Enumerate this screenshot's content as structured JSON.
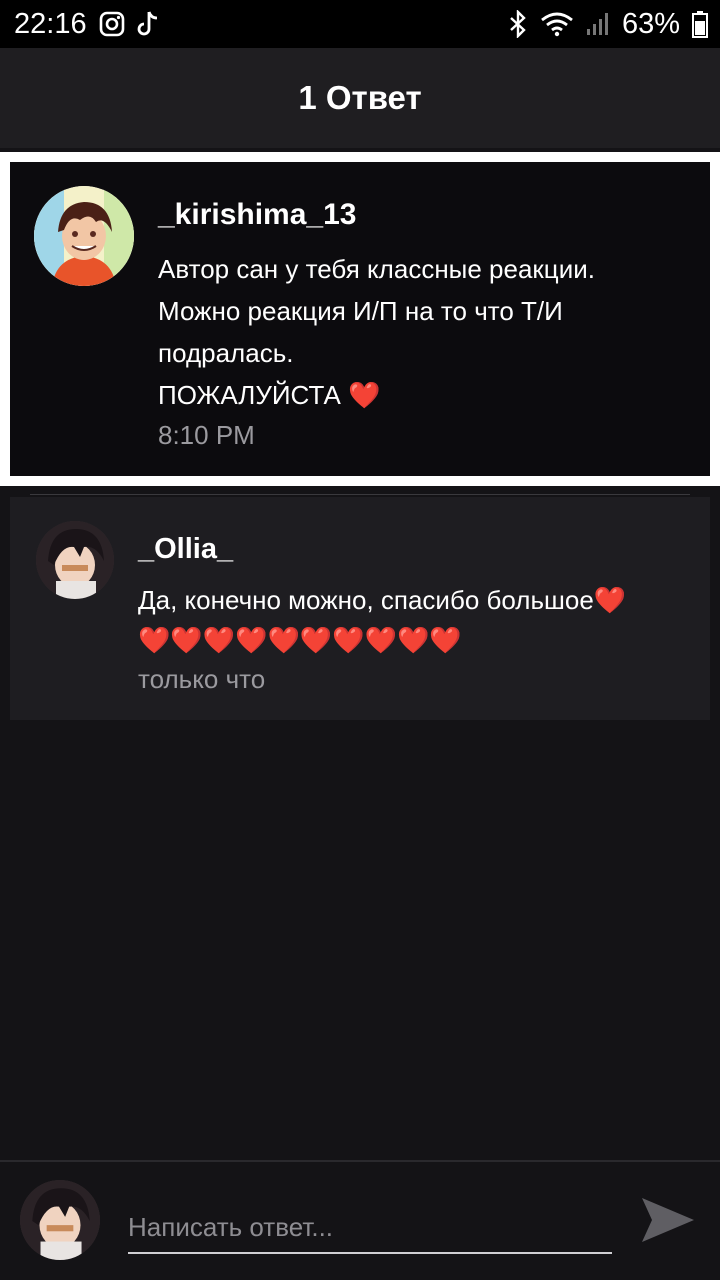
{
  "status_bar": {
    "time": "22:16",
    "battery_percent": "63%",
    "icons": [
      "instagram-icon",
      "tiktok-icon",
      "bluetooth-icon",
      "wifi-icon",
      "signal-icon",
      "battery-icon"
    ]
  },
  "header": {
    "title": "1 Ответ"
  },
  "original_comment": {
    "username": "_kirishima_13",
    "lines": [
      "Автор сан у тебя классные реакции.",
      "Можно реакция И/П на то что Т/И",
      "подралась.",
      "ПОЖАЛУЙСТА ❤️"
    ],
    "time": "8:10 PM"
  },
  "reply": {
    "username": "_Ollia_",
    "lines": [
      "Да, конечно можно, спасибо большое❤️",
      "❤️❤️❤️❤️❤️❤️❤️❤️❤️❤️"
    ],
    "time": "только что"
  },
  "composer": {
    "placeholder": "Написать ответ...",
    "send_icon": "send-icon"
  },
  "colors": {
    "background": "#141316",
    "header": "#1f1e21",
    "card": "#1e1d21",
    "highlight_border": "#ffffff",
    "muted_text": "#9b9a9f"
  }
}
